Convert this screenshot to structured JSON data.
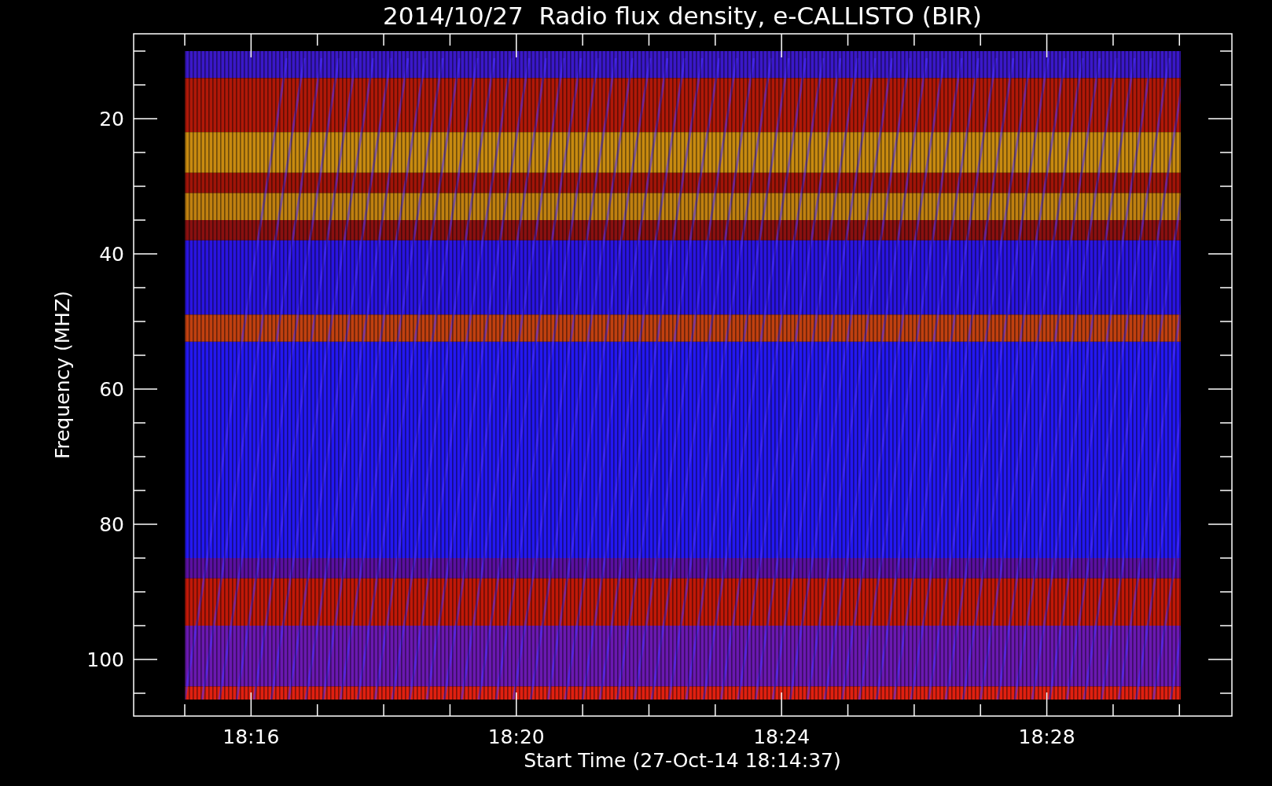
{
  "title": "2014/10/27  Radio flux density, e-CALLISTO (BIR)",
  "ylabel": "Frequency (MHZ)",
  "xlabel": "Start Time (27-Oct-14 18:14:37)",
  "yticks": [
    "20",
    "40",
    "60",
    "80",
    "100"
  ],
  "xticks": [
    "18:16",
    "18:20",
    "18:24",
    "18:28"
  ]
}
